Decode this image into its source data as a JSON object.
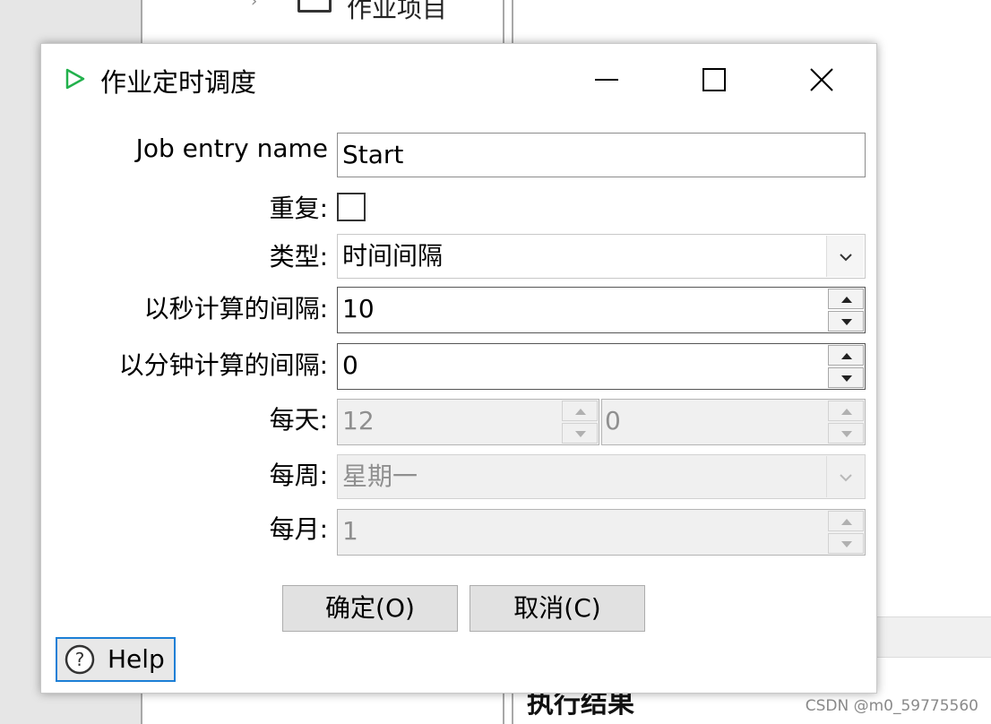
{
  "background": {
    "tree_item_label": "作业项目",
    "results_label": "执行结果",
    "watermark": "CSDN @m0_59775560"
  },
  "dialog": {
    "title": "作业定时调度",
    "fields": {
      "job_entry_name": {
        "label": "Job entry name",
        "value": "Start"
      },
      "repeat": {
        "label": "重复:",
        "checked": false
      },
      "type": {
        "label": "类型:",
        "value": "时间间隔"
      },
      "interval_seconds": {
        "label": "以秒计算的间隔:",
        "value": "10"
      },
      "interval_minutes": {
        "label": "以分钟计算的间隔:",
        "value": "0"
      },
      "daily": {
        "label": "每天:",
        "hour": "12",
        "minute": "0"
      },
      "weekly": {
        "label": "每周:",
        "value": "星期一"
      },
      "monthly": {
        "label": "每月:",
        "value": "1"
      }
    },
    "buttons": {
      "ok": "确定(O)",
      "cancel": "取消(C)",
      "help": "Help"
    }
  },
  "colors": {
    "title_icon": "#22b14c",
    "help_border": "#1c7fd6",
    "disabled_text": "#8f8f8f"
  }
}
